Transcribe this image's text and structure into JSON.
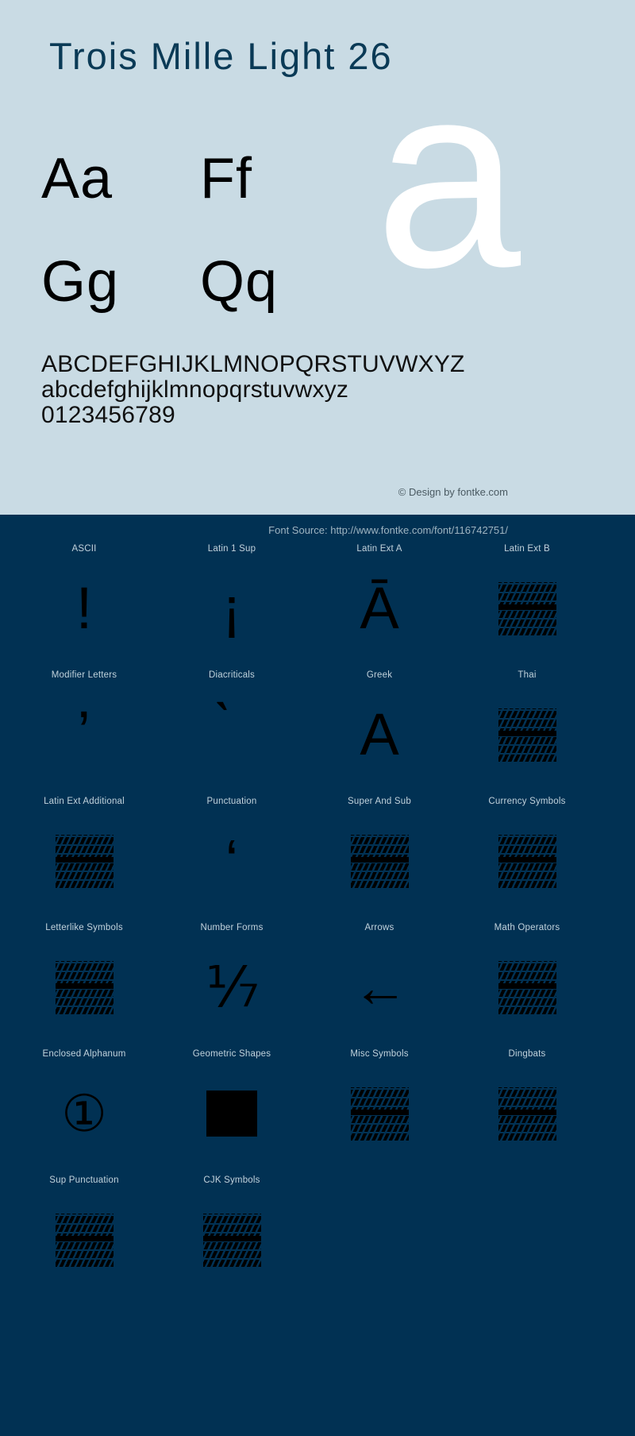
{
  "colors": {
    "top_background": "#c9dbe4",
    "bottom_background": "#013153",
    "title": "#0a3a56",
    "glyph": "#000000",
    "watermark": "#ffffff",
    "label": "#c2d2dc"
  },
  "header": {
    "title": "Trois Mille Light 26"
  },
  "preview": {
    "watermark_glyph": "a",
    "sample_rows": [
      {
        "left": "Aa",
        "right": "Ff"
      },
      {
        "left": "Gg",
        "right": "Qq"
      }
    ],
    "alphabet_lines": [
      "ABCDEFGHIJKLMNOPQRSTUVWXYZ",
      "abcdefghijklmnopqrstuvwxyz",
      "0123456789"
    ],
    "copyright": "© Design by fontke.com"
  },
  "source": {
    "label": "Font Source: http://www.fontke.com/font/116742751/"
  },
  "unicode_blocks": [
    {
      "label": "ASCII",
      "glyph": "!",
      "type": "char",
      "size": "normal"
    },
    {
      "label": "Latin 1 Sup",
      "glyph": "¡",
      "type": "char",
      "size": "normal"
    },
    {
      "label": "Latin Ext A",
      "glyph": "Ā",
      "type": "char",
      "size": "normal"
    },
    {
      "label": "Latin Ext B",
      "glyph": "",
      "type": "tofu",
      "size": "normal"
    },
    {
      "label": "Modifier Letters",
      "glyph": "ʼ",
      "type": "char",
      "size": "normal"
    },
    {
      "label": "Diacriticals",
      "glyph": "̀",
      "type": "char",
      "size": "normal"
    },
    {
      "label": "Greek",
      "glyph": "Α",
      "type": "char",
      "size": "normal"
    },
    {
      "label": "Thai",
      "glyph": "",
      "type": "tofu",
      "size": "normal"
    },
    {
      "label": "Latin Ext Additional",
      "glyph": "",
      "type": "tofu",
      "size": "normal"
    },
    {
      "label": "Punctuation",
      "glyph": "‘",
      "type": "char",
      "size": "normal"
    },
    {
      "label": "Super And Sub",
      "glyph": "",
      "type": "tofu",
      "size": "normal"
    },
    {
      "label": "Currency Symbols",
      "glyph": "",
      "type": "tofu",
      "size": "normal"
    },
    {
      "label": "Letterlike Symbols",
      "glyph": "",
      "type": "tofu",
      "size": "normal"
    },
    {
      "label": "Number Forms",
      "glyph": "⅐",
      "type": "char",
      "size": "wide"
    },
    {
      "label": "Arrows",
      "glyph": "←",
      "type": "char",
      "size": "wide"
    },
    {
      "label": "Math Operators",
      "glyph": "",
      "type": "tofu",
      "size": "normal"
    },
    {
      "label": "Enclosed Alphanum",
      "glyph": "①",
      "type": "char",
      "size": "small"
    },
    {
      "label": "Geometric Shapes",
      "glyph": "■",
      "type": "square",
      "size": "normal"
    },
    {
      "label": "Misc Symbols",
      "glyph": "",
      "type": "tofu",
      "size": "normal"
    },
    {
      "label": "Dingbats",
      "glyph": "",
      "type": "tofu",
      "size": "normal"
    },
    {
      "label": "Sup Punctuation",
      "glyph": "",
      "type": "tofu",
      "size": "normal"
    },
    {
      "label": "CJK Symbols",
      "glyph": "",
      "type": "tofu",
      "size": "normal"
    }
  ]
}
